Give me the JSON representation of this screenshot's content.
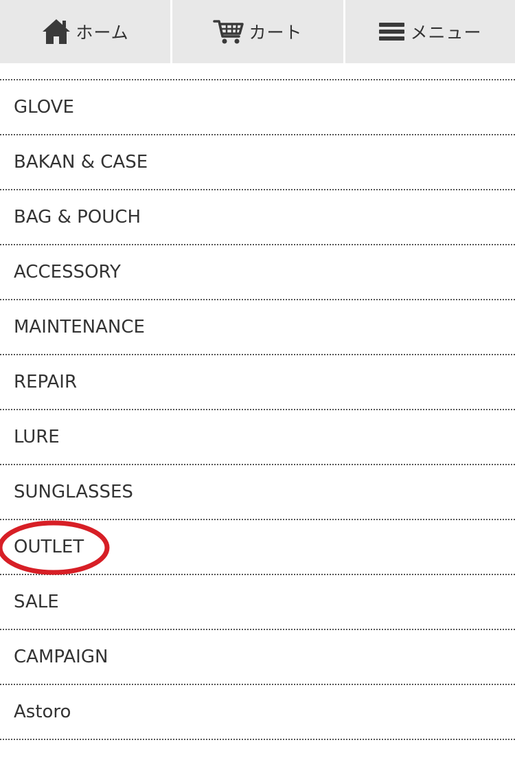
{
  "nav": {
    "home": {
      "label": "ホーム",
      "icon": "home-icon"
    },
    "cart": {
      "label": "カート",
      "icon": "cart-icon"
    },
    "menu": {
      "label": "メニュー",
      "icon": "hamburger-icon"
    }
  },
  "menu_list": {
    "items": [
      {
        "label": "GLOVE"
      },
      {
        "label": "BAKAN & CASE"
      },
      {
        "label": "BAG & POUCH"
      },
      {
        "label": "ACCESSORY"
      },
      {
        "label": "MAINTENANCE"
      },
      {
        "label": "REPAIR"
      },
      {
        "label": "LURE"
      },
      {
        "label": "SUNGLASSES"
      },
      {
        "label": "OUTLET"
      },
      {
        "label": "SALE"
      },
      {
        "label": "CAMPAIGN"
      },
      {
        "label": "Astoro"
      }
    ]
  },
  "annotation": {
    "highlight_color": "#d71f26"
  },
  "colors": {
    "nav_background": "#e8e8e8",
    "text": "#333333",
    "divider": "#555555"
  }
}
